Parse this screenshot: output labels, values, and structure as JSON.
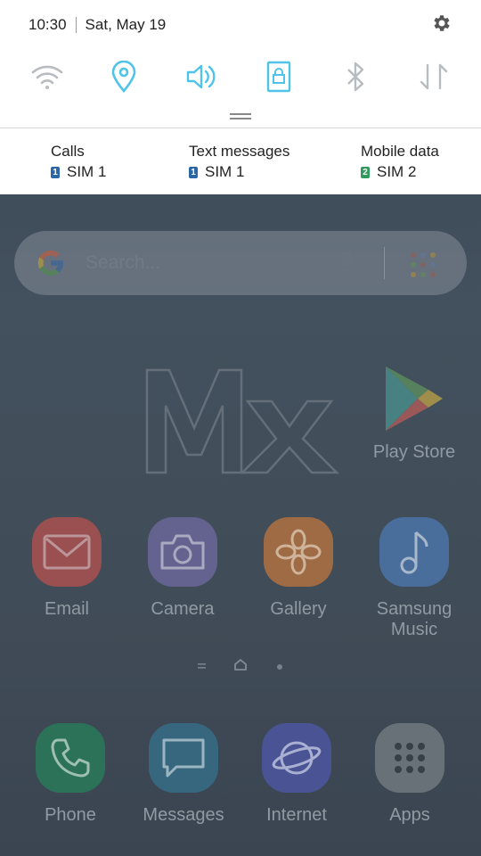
{
  "status_bar": {
    "time": "10:30",
    "date": "Sat, May 19"
  },
  "quick_settings": [
    {
      "name": "wifi",
      "icon": "wifi-icon",
      "active": false
    },
    {
      "name": "location",
      "icon": "location-icon",
      "active": true
    },
    {
      "name": "sound",
      "icon": "sound-icon",
      "active": true
    },
    {
      "name": "screen-rotation-lock",
      "icon": "rotation-lock-icon",
      "active": true
    },
    {
      "name": "bluetooth",
      "icon": "bluetooth-icon",
      "active": false
    },
    {
      "name": "mobile-data",
      "icon": "data-arrows-icon",
      "active": false
    }
  ],
  "sim_settings": [
    {
      "label": "Calls",
      "sim_number": "1",
      "sim_name": "SIM 1",
      "color": "#2b66a8"
    },
    {
      "label": "Text messages",
      "sim_number": "1",
      "sim_name": "SIM 1",
      "color": "#2b66a8"
    },
    {
      "label": "Mobile data",
      "sim_number": "2",
      "sim_name": "SIM 2",
      "color": "#2f9a5c"
    }
  ],
  "search": {
    "placeholder": "Search..."
  },
  "home_apps": [
    {
      "name": "Play Store"
    },
    {
      "name": "Email",
      "color": "#a45456"
    },
    {
      "name": "Camera",
      "color": "#6b6a9a"
    },
    {
      "name": "Gallery",
      "color": "#a8724a"
    },
    {
      "name": "Samsung Music",
      "color": "#4e75a6"
    }
  ],
  "dock_apps": [
    {
      "name": "Phone",
      "color": "#2f7a5e"
    },
    {
      "name": "Messages",
      "color": "#3b6e86"
    },
    {
      "name": "Internet",
      "color": "#4f5a9e"
    },
    {
      "name": "Apps",
      "color": "#6f7880"
    }
  ],
  "colors": {
    "accent": "#4fc3e8",
    "inactive": "#b8bcc0"
  }
}
